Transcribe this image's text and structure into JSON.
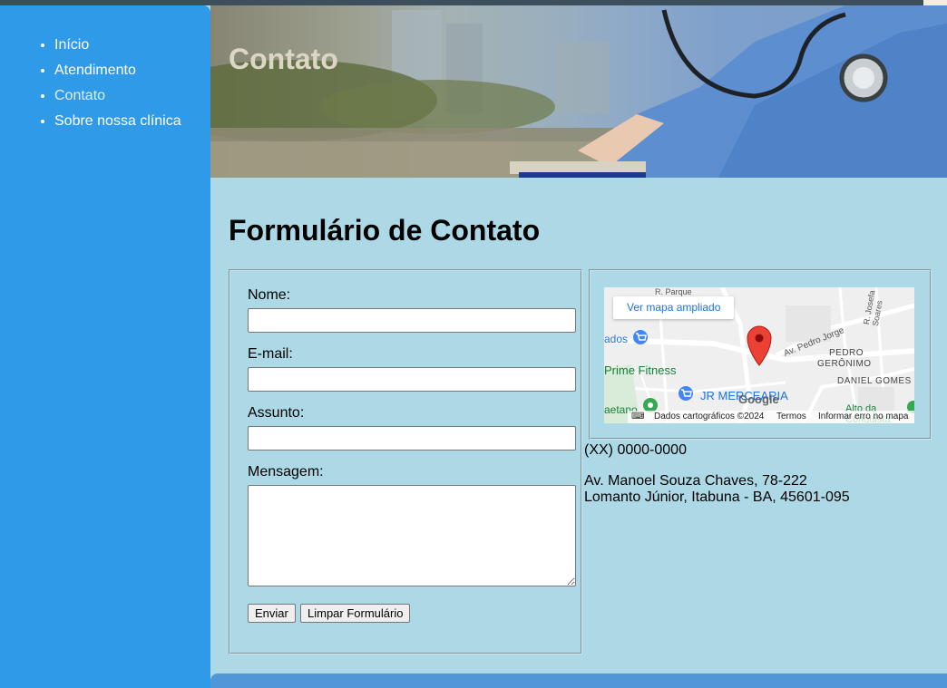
{
  "nav": {
    "items": [
      {
        "label": "Início",
        "active": false
      },
      {
        "label": "Atendimento",
        "active": false
      },
      {
        "label": "Contato",
        "active": true
      },
      {
        "label": "Sobre nossa clínica",
        "active": false
      }
    ]
  },
  "banner": {
    "title": "Contato"
  },
  "form": {
    "heading": "Formulário de Contato",
    "fields": {
      "name_label": "Nome:",
      "name_value": "",
      "email_label": "E-mail:",
      "email_value": "",
      "subject_label": "Assunto:",
      "subject_value": "",
      "message_label": "Mensagem:",
      "message_value": ""
    },
    "submit_label": "Enviar",
    "reset_label": "Limpar Formulário"
  },
  "map": {
    "link_label": "Ver mapa ampliado",
    "labels": {
      "street_1": "R. Parque",
      "street_2": "Av. Pedro Jorge",
      "street_3": "R. Josefa Soares",
      "district_1": "PEDRO",
      "district_2": "GERÔNIMO",
      "district_3": "DANIEL GOMES",
      "place_1": "Prime Fitness",
      "place_2": "JR MERCEARIA",
      "place_3": "ados",
      "place_4": "aetano",
      "place_5": "Alto da Conquista",
      "brand": "Google"
    },
    "footer": {
      "attribution": "Dados cartográficos ©2024",
      "terms": "Termos",
      "report": "Informar erro no mapa"
    }
  },
  "contact": {
    "phone": "(XX) 0000-0000",
    "address_line1": "Av. Manoel Souza Chaves, 78-222",
    "address_line2": "Lomanto Júnior, Itabuna - BA, 45601-095"
  },
  "colors": {
    "sidebar": "#2f9ae8",
    "page_background": "#add8e6",
    "footer": "#4f97d8",
    "map_pin": "#ea4335",
    "map_link": "#1a73e8"
  }
}
